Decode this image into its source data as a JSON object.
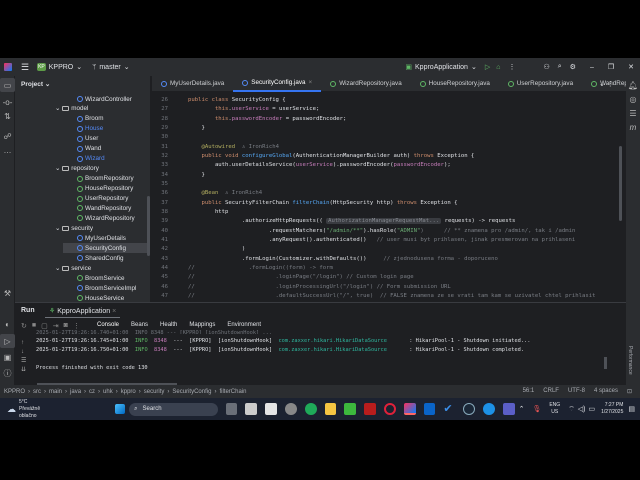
{
  "titlebar": {
    "project_badge": "KP",
    "project": "KPPRO",
    "branch": "master",
    "run_config": "KpproApplication"
  },
  "project_panel": {
    "title": "Project",
    "items": [
      {
        "label": "WizardController",
        "kind": "class",
        "indent": 3
      },
      {
        "label": "model",
        "kind": "folder",
        "indent": 2
      },
      {
        "label": "Broom",
        "kind": "class",
        "indent": 3
      },
      {
        "label": "House",
        "kind": "class",
        "indent": 3,
        "color": "#548af7"
      },
      {
        "label": "User",
        "kind": "class",
        "indent": 3
      },
      {
        "label": "Wand",
        "kind": "class",
        "indent": 3
      },
      {
        "label": "Wizard",
        "kind": "class",
        "indent": 3,
        "color": "#548af7"
      },
      {
        "label": "repository",
        "kind": "folder",
        "indent": 2
      },
      {
        "label": "BroomRepository",
        "kind": "interface",
        "indent": 3
      },
      {
        "label": "HouseRepository",
        "kind": "interface",
        "indent": 3
      },
      {
        "label": "UserRepository",
        "kind": "interface",
        "indent": 3
      },
      {
        "label": "WandRepository",
        "kind": "interface",
        "indent": 3
      },
      {
        "label": "WizardRepository",
        "kind": "interface",
        "indent": 3
      },
      {
        "label": "security",
        "kind": "folder",
        "indent": 2
      },
      {
        "label": "MyUserDetails",
        "kind": "class",
        "indent": 3
      },
      {
        "label": "SecurityConfig",
        "kind": "class",
        "indent": 3,
        "selected": true
      },
      {
        "label": "SharedConfig",
        "kind": "class",
        "indent": 3
      },
      {
        "label": "service",
        "kind": "folder",
        "indent": 2
      },
      {
        "label": "BroomService",
        "kind": "interface",
        "indent": 3
      },
      {
        "label": "BroomServiceImpl",
        "kind": "class",
        "indent": 3
      },
      {
        "label": "HouseService",
        "kind": "interface",
        "indent": 3
      }
    ]
  },
  "tabs": [
    {
      "label": "MyUserDetails.java",
      "active": false
    },
    {
      "label": "SecurityConfig.java",
      "active": true
    },
    {
      "label": "WizardRepository.java",
      "active": false
    },
    {
      "label": "HouseRepository.java",
      "active": false
    },
    {
      "label": "UserRepository.java",
      "active": false
    },
    {
      "label": "WandReposi",
      "active": false
    }
  ],
  "inspections": {
    "warnings": "2",
    "checks": "27"
  },
  "code_lines": [
    {
      "n": "26",
      "t": [
        [
          "public class ",
          "kw"
        ],
        [
          "SecurityConfig {",
          ""
        ]
      ]
    },
    {
      "n": "27",
      "t": [
        [
          "        this",
          "kw"
        ],
        [
          ".",
          ""
        ],
        [
          "userService",
          "pu"
        ],
        [
          " = userService;",
          ""
        ]
      ]
    },
    {
      "n": "28",
      "t": [
        [
          "        this",
          "kw"
        ],
        [
          ".",
          ""
        ],
        [
          "passwordEncoder",
          "pu"
        ],
        [
          " = passwordEncoder;",
          ""
        ]
      ]
    },
    {
      "n": "29",
      "t": [
        [
          "    }",
          ""
        ]
      ]
    },
    {
      "n": "30",
      "t": [
        [
          "",
          ""
        ]
      ]
    },
    {
      "n": "31",
      "t": [
        [
          "    @Autowired",
          "an"
        ],
        [
          "  ♙ IronRich4",
          "cm"
        ]
      ]
    },
    {
      "n": "32",
      "t": [
        [
          "    public void ",
          "kw"
        ],
        [
          "configureGlobal",
          "fn"
        ],
        [
          "(AuthenticationManagerBuilder auth) ",
          ""
        ],
        [
          "throws ",
          "kw"
        ],
        [
          "Exception {",
          ""
        ]
      ]
    },
    {
      "n": "33",
      "t": [
        [
          "        auth.userDetailsService(",
          ""
        ],
        [
          "userService",
          "pu"
        ],
        [
          ").passwordEncoder(",
          ""
        ],
        [
          "passwordEncoder",
          "pu"
        ],
        [
          ");",
          ""
        ]
      ]
    },
    {
      "n": "34",
      "t": [
        [
          "    }",
          ""
        ]
      ]
    },
    {
      "n": "35",
      "t": [
        [
          "",
          ""
        ]
      ]
    },
    {
      "n": "36",
      "t": [
        [
          "    @Bean",
          "an"
        ],
        [
          "  ♙ IronRich4",
          "cm"
        ]
      ]
    },
    {
      "n": "37",
      "t": [
        [
          "    public ",
          "kw"
        ],
        [
          "SecurityFilterChain ",
          ""
        ],
        [
          "filterChain",
          "fn"
        ],
        [
          "(HttpSecurity http) ",
          ""
        ],
        [
          "throws ",
          "kw"
        ],
        [
          "Exception {",
          ""
        ]
      ]
    },
    {
      "n": "38",
      "t": [
        [
          "        http",
          ""
        ]
      ]
    },
    {
      "n": "39",
      "t": [
        [
          "                .authorizeHttpRequests(( ",
          ""
        ],
        [
          "AuthorizationManagerRequestMat...",
          "hint"
        ],
        [
          " requests) -> requests",
          ""
        ]
      ]
    },
    {
      "n": "40",
      "t": [
        [
          "                        .requestMatchers(",
          ""
        ],
        [
          "\"/admin/**\"",
          "str"
        ],
        [
          ").hasRole(",
          ""
        ],
        [
          "\"ADMIN\"",
          "str"
        ],
        [
          ")      // ** znamena pro /admin/, tak i /admin",
          "cm"
        ]
      ]
    },
    {
      "n": "41",
      "t": [
        [
          "                        .anyRequest().authenticated()   ",
          ""
        ],
        [
          "// user musi byt prihlasen, jinak presmerovan na prihlaseni",
          "cm"
        ]
      ]
    },
    {
      "n": "42",
      "t": [
        [
          "                )",
          ""
        ]
      ]
    },
    {
      "n": "43",
      "t": [
        [
          "                .formLogin(Customizer.withDefaults())     ",
          ""
        ],
        [
          "// zjednodusena forma - doporuceno",
          "cm"
        ]
      ]
    },
    {
      "n": "44",
      "t": [
        [
          "//                .formLogin((form) -> form",
          "cm"
        ]
      ]
    },
    {
      "n": "45",
      "t": [
        [
          "//                        .loginPage(\"/login\") // Custom login page",
          "cm"
        ]
      ]
    },
    {
      "n": "46",
      "t": [
        [
          "//                        .loginProcessingUrl(\"/login\") // Form submission URL",
          "cm"
        ]
      ]
    },
    {
      "n": "47",
      "t": [
        [
          "//                        .defaultSuccessUrl(\"/\", true)  // FALSE znamena ze se vrati tam kam se uzivatel chtel prihlasit",
          "cm"
        ]
      ]
    }
  ],
  "run": {
    "title": "Run",
    "config_tab": "KpproApplication",
    "tabs": [
      "Console",
      "Beans",
      "Health",
      "Mappings",
      "Environment"
    ],
    "log": [
      {
        "ts": "2025-01-27T19:26:16.745+01:00",
        "level": "INFO",
        "pid": "8348",
        "sep": "---",
        "app": "[KPPRO]",
        "thread": "[ionShutdownHook]",
        "logger": "com.zaxxer.hikari.HikariDataSource",
        "msg": ": HikariPool-1 - Shutdown initiated..."
      },
      {
        "ts": "2025-01-27T19:26:16.750+01:00",
        "level": "INFO",
        "pid": "8348",
        "sep": "---",
        "app": "[KPPRO]",
        "thread": "[ionShutdownHook]",
        "logger": "com.zaxxer.hikari.HikariDataSource",
        "msg": ": HikariPool-1 - Shutdown completed."
      }
    ],
    "exit": "Process finished with exit code 130",
    "side_label": "Performance"
  },
  "breadcrumb": [
    "KPPRO",
    "src",
    "main",
    "java",
    "cz",
    "uhk",
    "kppro",
    "security",
    "SecurityConfig",
    "filterChain"
  ],
  "status": {
    "position": "56:1",
    "line_ending": "CRLF",
    "encoding": "UTF-8",
    "indent": "4 spaces"
  },
  "taskbar": {
    "temp": "5°C",
    "weather": "Převážně oblačno",
    "search": "Search",
    "lang1": "ENG",
    "lang2": "US",
    "time": "7:27 PM",
    "date": "1/27/2025"
  },
  "colors": {
    "accent": "#3574f0",
    "bg": "#1e1f22",
    "panel": "#2b2d30"
  }
}
